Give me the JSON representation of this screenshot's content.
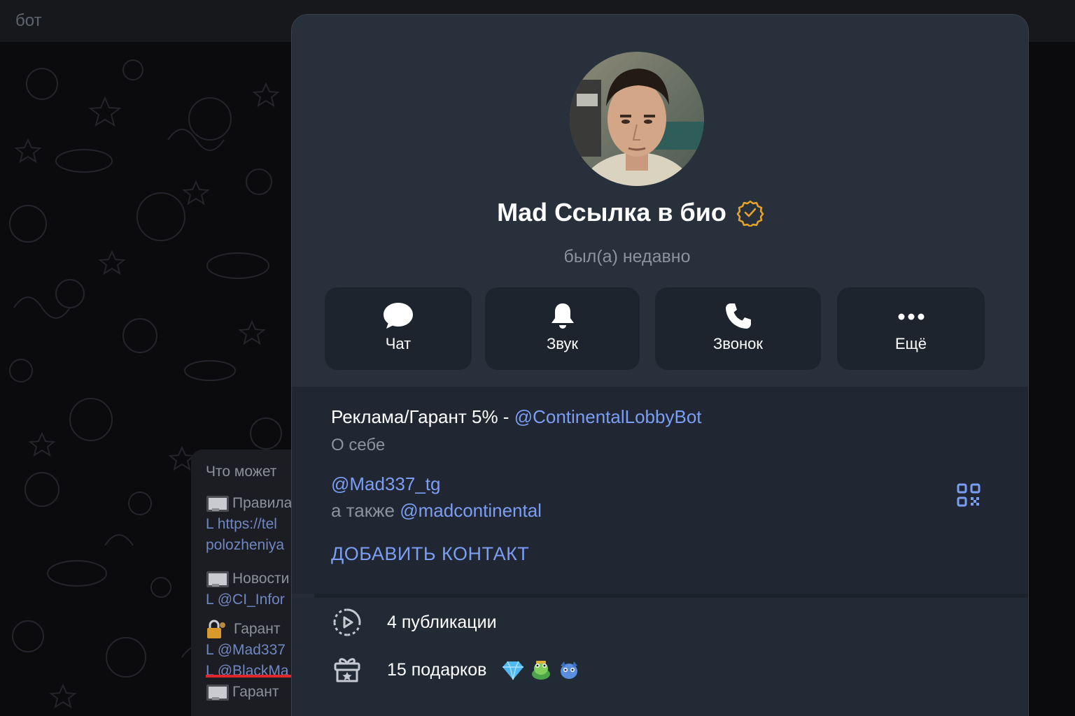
{
  "chat": {
    "title": "бот",
    "bot_info": {
      "caption": "Что может",
      "items": [
        {
          "icon": "monitor-icon",
          "label": "Правила",
          "link": "L https://tel",
          "link2": "polozheniya"
        },
        {
          "icon": "monitor-icon",
          "label": "Новости",
          "link": "L @CI_Infor"
        },
        {
          "icon": "lock-key-icon",
          "label": "Гарант",
          "link": "L @Mad337",
          "link2": "L @BlackMa"
        },
        {
          "label": "Гарант"
        }
      ]
    }
  },
  "profile": {
    "name": "Mad Ссылка в био",
    "status": "был(а) недавно",
    "actions": [
      {
        "label": "Чат",
        "icon": "chat-bubble-icon"
      },
      {
        "label": "Звук",
        "icon": "bell-icon"
      },
      {
        "label": "Звонок",
        "icon": "phone-icon"
      },
      {
        "label": "Ещё",
        "icon": "more-dots-icon"
      }
    ],
    "bio_text": "Реклама/Гарант 5% - ",
    "bio_link": "@ContinentalLobbyBot",
    "bio_caption": "О себе",
    "username": "@Mad337_tg",
    "also_text": "а также ",
    "also_link": "@madcontinental",
    "add_contact": "ДОБАВИТЬ КОНТАКТ",
    "publications": "4 публикации",
    "gifts": "15 подарков",
    "gift_icons": [
      "diamond-icon",
      "green-frog-icon",
      "blue-creature-icon"
    ]
  },
  "colors": {
    "accent": "#7b9ef4",
    "verified": "#e8a32a",
    "panel_bg": "#252c37",
    "highlight_underline": "#e0262b"
  }
}
